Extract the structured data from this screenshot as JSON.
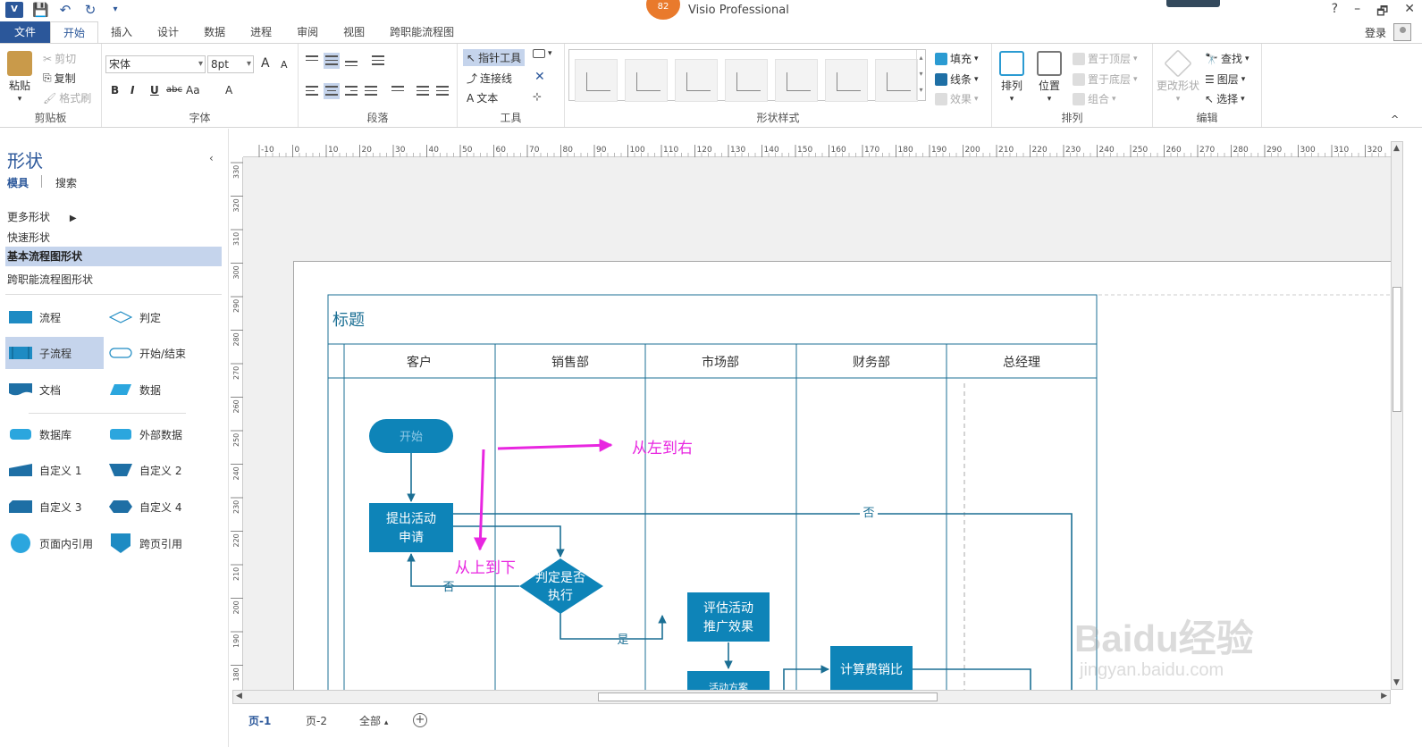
{
  "titlebar": {
    "app_title": "Visio Professional",
    "badge": "82",
    "window_controls": [
      "?",
      "–",
      "🗗",
      "✕"
    ]
  },
  "tabs": [
    "文件",
    "开始",
    "插入",
    "设计",
    "数据",
    "进程",
    "审阅",
    "视图",
    "跨职能流程图"
  ],
  "active_tab_index": 1,
  "account": {
    "login": "登录"
  },
  "ribbon": {
    "clipboard": {
      "paste": "粘贴",
      "cut": "剪切",
      "copy": "复制",
      "format_painter": "格式刷",
      "label": "剪贴板"
    },
    "font": {
      "font_name": "宋体",
      "font_size": "8pt",
      "grow": "A",
      "shrink": "A",
      "bold": "B",
      "italic": "I",
      "underline": "U",
      "strike": "abc",
      "case": "Aa",
      "color": "A",
      "label": "字体"
    },
    "paragraph": {
      "label": "段落"
    },
    "tools": {
      "pointer": "指针工具",
      "connector": "连接线",
      "text": "文本",
      "label": "工具"
    },
    "shape_styles": {
      "fill": "填充",
      "line": "线条",
      "effects": "效果",
      "label": "形状样式"
    },
    "arrange": {
      "arrange": "排列",
      "position": "位置",
      "bring_front": "置于顶层",
      "send_back": "置于底层",
      "group": "组合",
      "label": "排列"
    },
    "editing": {
      "change_shape": "更改形状",
      "find": "查找",
      "layers": "图层",
      "select": "选择",
      "label": "编辑"
    }
  },
  "shapes_pane": {
    "title": "形状",
    "tabs": [
      "模具",
      "搜索"
    ],
    "links": [
      "更多形状",
      "快速形状",
      "基本流程图形状",
      "跨职能流程图形状"
    ],
    "selected_link_index": 2,
    "shapes": [
      {
        "label": "流程",
        "icon": "process-icon"
      },
      {
        "label": "判定",
        "icon": "decision-icon"
      },
      {
        "label": "子流程",
        "icon": "subprocess-icon"
      },
      {
        "label": "开始/结束",
        "icon": "start-end-icon"
      },
      {
        "label": "文档",
        "icon": "document-icon"
      },
      {
        "label": "数据",
        "icon": "data-icon"
      },
      {
        "label": "数据库",
        "icon": "database-icon"
      },
      {
        "label": "外部数据",
        "icon": "external-data-icon"
      },
      {
        "label": "自定义 1",
        "icon": "custom1-icon"
      },
      {
        "label": "自定义 2",
        "icon": "custom2-icon"
      },
      {
        "label": "自定义 3",
        "icon": "custom3-icon"
      },
      {
        "label": "自定义 4",
        "icon": "custom4-icon"
      },
      {
        "label": "页面内引用",
        "icon": "on-page-ref-icon"
      },
      {
        "label": "跨页引用",
        "icon": "off-page-ref-icon"
      }
    ],
    "selected_shape_index": 2
  },
  "ruler": {
    "top_ticks": [
      "-10",
      "0",
      "10",
      "20",
      "30",
      "40",
      "50",
      "60",
      "70",
      "80",
      "90",
      "100",
      "110",
      "120",
      "130",
      "140",
      "150",
      "160",
      "170",
      "180",
      "190",
      "200",
      "210",
      "220",
      "230",
      "240",
      "250",
      "260",
      "270",
      "280",
      "290",
      "300",
      "310",
      "320"
    ],
    "left_ticks": [
      "330",
      "320",
      "310",
      "300",
      "290",
      "280",
      "270",
      "260",
      "250",
      "240",
      "230",
      "220",
      "210",
      "200",
      "190",
      "180"
    ]
  },
  "diagram": {
    "title": "标题",
    "lanes": [
      "客户",
      "销售部",
      "市场部",
      "财务部",
      "总经理"
    ],
    "shapes": {
      "start": "开始",
      "request_line1": "提出活动",
      "request_line2": "申请",
      "decision_line1": "判定是否",
      "decision_line2": "执行",
      "evaluate_line1": "评估活动",
      "evaluate_line2": "推广效果",
      "plan": "活动方案",
      "calc": "计算费销比"
    },
    "edge_labels": {
      "no_top": "否",
      "no_back": "否",
      "yes": "是"
    },
    "annotations": {
      "left_to_right": "从左到右",
      "top_to_bottom": "从上到下"
    },
    "colors": {
      "shape_fill": "#0e84b8",
      "lane_line": "#1b6f94",
      "annotation": "#e826e0"
    }
  },
  "watermark": {
    "text": "Baidu经验",
    "url": "jingyan.baidu.com"
  },
  "page_tabs": [
    "页-1",
    "页-2",
    "全部"
  ],
  "active_page_index": 0
}
